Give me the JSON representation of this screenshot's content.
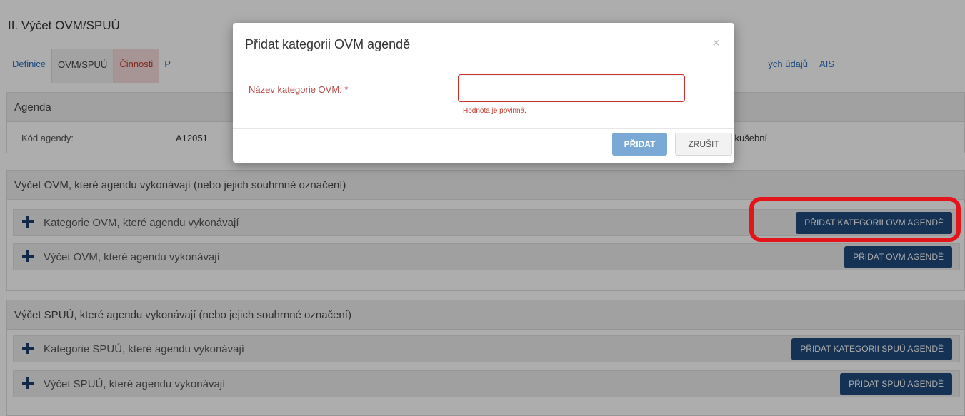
{
  "page": {
    "title": "II. Výčet OVM/SPUÚ"
  },
  "tabs": [
    {
      "label": "Definice"
    },
    {
      "label": "OVM/SPUÚ"
    },
    {
      "label": "Činnosti"
    },
    {
      "label": "P"
    }
  ],
  "tabs_right": [
    {
      "label": "ých údajů"
    },
    {
      "label": "AIS"
    }
  ],
  "agenda": {
    "header": "Agenda",
    "code_label": "Kód agendy:",
    "code_value": "A12051",
    "extra_value": "zkušební"
  },
  "ovm_section": {
    "header": "Výčet OVM, které agendu vykonávají (nebo jejich souhrnné označení)",
    "rows": [
      {
        "label": "Kategorie OVM, které agendu vykonávají",
        "button": "PŘIDAT KATEGORII OVM AGENDĚ"
      },
      {
        "label": "Výčet OVM, které agendu vykonávají",
        "button": "PŘIDAT OVM AGENDĚ"
      }
    ]
  },
  "spuu_section": {
    "header": "Výčet SPUÚ, které agendu vykonávají (nebo jejich souhrnné označení)",
    "rows": [
      {
        "label": "Kategorie SPUÚ, které agendu vykonávají",
        "button": "PŘIDAT KATEGORII SPUÚ AGENDĚ"
      },
      {
        "label": "Výčet SPUÚ, které agendu vykonávají",
        "button": "PŘIDAT SPUÚ AGENDĚ"
      }
    ]
  },
  "modal": {
    "title": "Přidat kategorii OVM agendě",
    "close": "×",
    "field_label": "Název kategorie OVM: *",
    "field_value": "",
    "error": "Hodnota je povinná.",
    "add_button": "PŘIDAT",
    "cancel_button": "ZRUŠIT"
  },
  "colors": {
    "primary_dark": "#1f4b7d",
    "highlight": "#e3151a",
    "error": "#c0392b"
  }
}
